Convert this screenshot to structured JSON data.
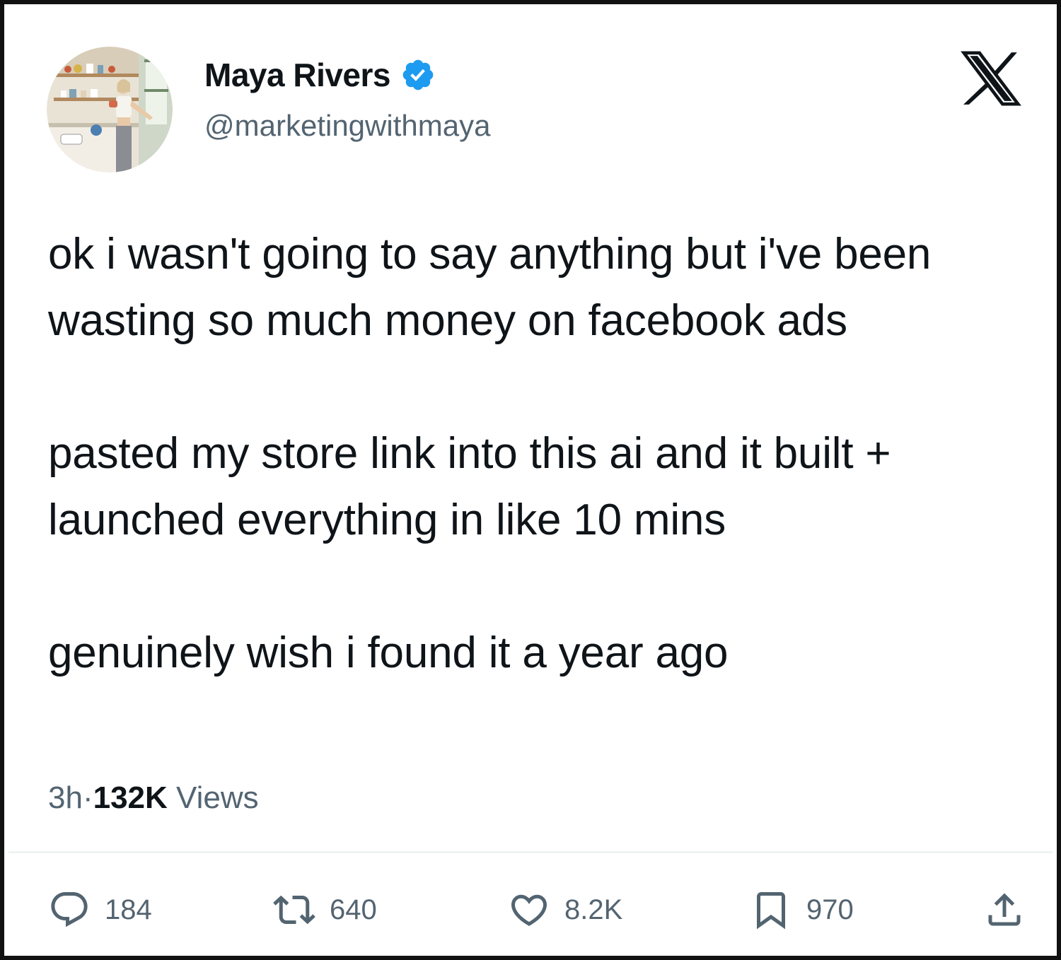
{
  "author": {
    "display_name": "Maya Rivers",
    "handle": "@marketingwithmaya",
    "verified": true,
    "verified_color": "#1d9bf0"
  },
  "platform": {
    "logo": "x-logo-icon"
  },
  "tweet": {
    "paragraphs": [
      "ok i wasn't going to say anything but i've been wasting so much money on facebook ads",
      "pasted my store link into this ai and it built + launched everything in like 10 mins",
      "genuinely wish i found it a year ago"
    ],
    "time": "3h",
    "separator": "·",
    "views_count": "132K",
    "views_label": " Views"
  },
  "actions": {
    "reply": {
      "icon": "reply-icon",
      "count": "184"
    },
    "retweet": {
      "icon": "retweet-icon",
      "count": "640"
    },
    "like": {
      "icon": "heart-icon",
      "count": "8.2K"
    },
    "bookmark": {
      "icon": "bookmark-icon",
      "count": "970"
    },
    "share": {
      "icon": "share-icon"
    }
  },
  "colors": {
    "text_primary": "#0f1419",
    "text_secondary": "#536471",
    "accent": "#1d9bf0",
    "border": "#111111",
    "divider": "#eff3f4"
  }
}
